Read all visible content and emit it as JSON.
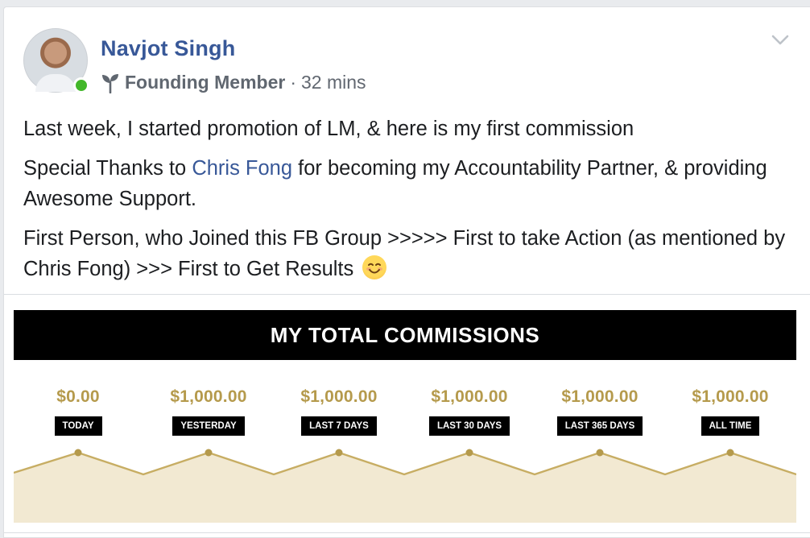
{
  "post": {
    "author": "Navjot Singh",
    "badge": "Founding Member",
    "separator": "·",
    "time": "32 mins",
    "paragraph1": "Last week, I started promotion of LM, & here is my first commission",
    "paragraph2_before": "Special Thanks to ",
    "paragraph2_link": "Chris Fong",
    "paragraph2_after": " for becoming my Accountability Partner, & providing Awesome Support.",
    "paragraph3": "First Person, who Joined this FB Group >>>>> First to take Action (as mentioned by Chris Fong) >>> First to Get Results",
    "emoji": "smiling-face-emoji"
  },
  "graphic": {
    "title": "MY TOTAL COMMISSIONS",
    "stats": [
      {
        "amount": "$0.00",
        "label": "TODAY"
      },
      {
        "amount": "$1,000.00",
        "label": "YESTERDAY"
      },
      {
        "amount": "$1,000.00",
        "label": "LAST 7 DAYS"
      },
      {
        "amount": "$1,000.00",
        "label": "LAST 30 DAYS"
      },
      {
        "amount": "$1,000.00",
        "label": "LAST 365 DAYS"
      },
      {
        "amount": "$1,000.00",
        "label": "ALL TIME"
      }
    ]
  },
  "icons": {
    "badge_icon": "sprout-icon",
    "menu_icon": "chevron-down-icon",
    "presence": "online-status-icon"
  },
  "colors": {
    "author": "#385898",
    "link": "#385898",
    "gold": "#b59a4c",
    "wave_fill": "#f2e9d2",
    "online": "#42b72a"
  }
}
